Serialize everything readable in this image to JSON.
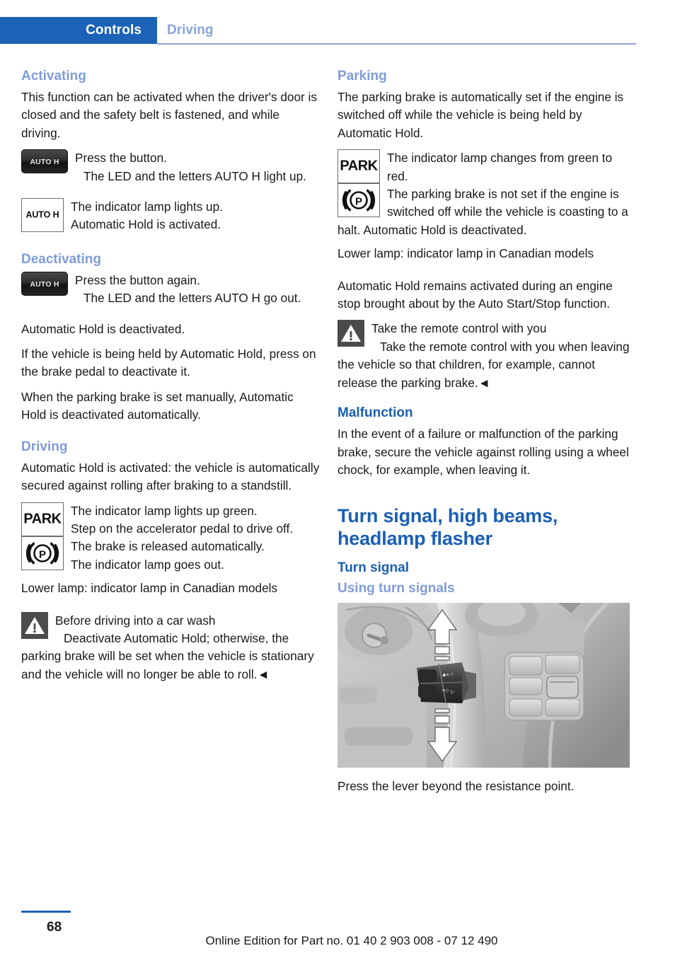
{
  "header": {
    "tab_label": "Controls",
    "section_label": "Driving"
  },
  "left_column": {
    "activating": {
      "heading": "Activating",
      "intro": "This function can be activated when the driver's door is closed and the safety belt is fastened, and while driving.",
      "button_icon_label": "AUTO H",
      "step1_line1": "Press the button.",
      "step1_line2": "The LED and the letters AUTO H light up.",
      "lamp_icon_label": "AUTO H",
      "step2_line1": "The indicator lamp lights up.",
      "step2_line2": "Automatic Hold is activated."
    },
    "deactivating": {
      "heading": "Deactivating",
      "button_icon_label": "AUTO H",
      "step1_line1": "Press the button again.",
      "step1_line2": "The LED and the letters AUTO H go out.",
      "para1": "Automatic Hold is deactivated.",
      "para2": "If the vehicle is being held by Automatic Hold, press on the brake pedal to deactivate it.",
      "para3": "When the parking brake is set manually, Automatic Hold is deactivated automatically."
    },
    "driving": {
      "heading": "Driving",
      "intro": "Automatic Hold is activated: the vehicle is automatically secured against rolling after braking to a standstill.",
      "park_icon_label": "PARK",
      "brake_icon_label": "((P))",
      "line1": "The indicator lamp lights up green.",
      "line2": "Step on the accelerator pedal to drive off.",
      "line3": "The brake is released automatically.",
      "line4": "The indicator lamp goes out.",
      "note": "Lower lamp: indicator lamp in Canadian models"
    },
    "warning": {
      "icon_label": "warning-triangle",
      "title": "Before driving into a car wash",
      "body": "Deactivate Automatic Hold; otherwise, the parking brake will be set when the vehicle is stationary and the vehicle will no longer be able to roll.◄"
    }
  },
  "right_column": {
    "parking": {
      "heading": "Parking",
      "intro": "The parking brake is automatically set if the engine is switched off while the vehicle is being held by Automatic Hold.",
      "park_icon_label": "PARK",
      "brake_icon_label": "((P))",
      "line1": "The indicator lamp changes from green to red.",
      "line2": "The parking brake is not set if the engine is switched off while the vehicle is coasting to a halt. Automatic Hold is deactivated.",
      "note": "Lower lamp: indicator lamp in Canadian models",
      "para": "Automatic Hold remains activated during an engine stop brought about by the Auto Start/Stop function."
    },
    "warning": {
      "icon_label": "warning-triangle",
      "title": "Take the remote control with you",
      "body": "Take the remote control with you when leaving the vehicle so that children, for example, cannot release the parking brake.◄"
    },
    "malfunction": {
      "heading": "Malfunction",
      "body": "In the event of a failure or malfunction of the parking brake, secure the vehicle against rolling using a wheel chock, for example, when leaving it."
    },
    "turn_signal": {
      "chapter_title": "Turn signal, high beams, headlamp flasher",
      "section_heading": "Turn signal",
      "sub_heading": "Using turn signals",
      "photo_alt": "steering-column-turn-signal-lever",
      "caption": "Press the lever beyond the resistance point."
    }
  },
  "footer": {
    "page_number": "68",
    "edition": "Online Edition for Part no. 01 40 2 903 008 - 07 12 490"
  },
  "colors": {
    "tab_blue": "#1c62b6",
    "heading_blue_light": "#7f9cdb",
    "heading_blue_dark": "#1a5fb4",
    "warning_box": "#4b4b4b",
    "button_dark": "#2e2e2e"
  }
}
